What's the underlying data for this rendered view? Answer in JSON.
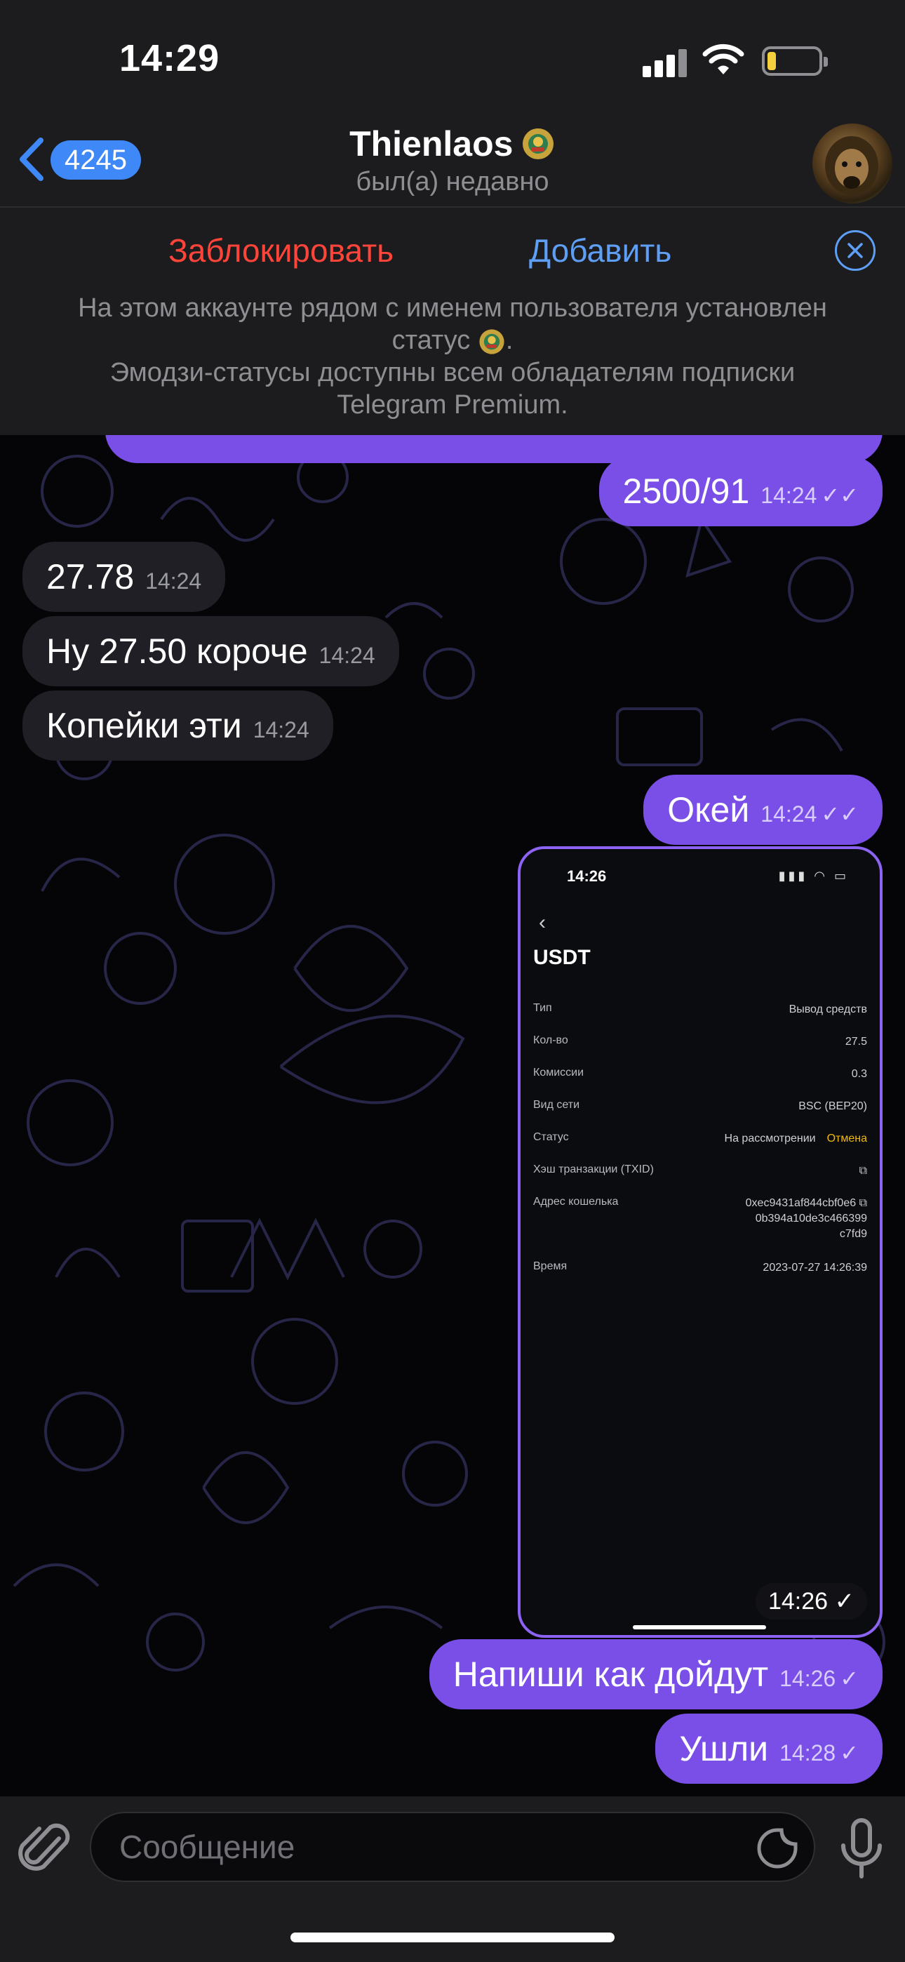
{
  "status_bar": {
    "time": "14:29"
  },
  "header": {
    "back_count": "4245",
    "title": "Thienlaos",
    "subtitle": "был(а) недавно"
  },
  "banner": {
    "block_label": "Заблокировать",
    "add_label": "Добавить",
    "line1": "На этом аккаунте рядом с именем пользователя установлен",
    "line2": "статус",
    "line3": "Эмодзи-статусы доступны всем обладателям подписки",
    "line4": "Telegram Premium."
  },
  "messages": [
    {
      "text": "2500/91",
      "time": "14:24",
      "direction": "out",
      "status": "read"
    },
    {
      "text": "27.78",
      "time": "14:24",
      "direction": "in"
    },
    {
      "text": "Ну 27.50 короче",
      "time": "14:24",
      "direction": "in"
    },
    {
      "text": "Копейки эти",
      "time": "14:24",
      "direction": "in"
    },
    {
      "text": "Окей",
      "time": "14:24",
      "direction": "out",
      "status": "read"
    },
    {
      "text": "Напиши как дойдут",
      "time": "14:26",
      "direction": "out",
      "status": "sent"
    },
    {
      "text": "Ушли",
      "time": "14:28",
      "direction": "out",
      "status": "sent"
    }
  ],
  "photo_message": {
    "time": "14:26",
    "status": "sent",
    "screenshot": {
      "time": "14:26",
      "title": "USDT",
      "rows": [
        {
          "label": "Тип",
          "value": "Вывод средств"
        },
        {
          "label": "Кол-во",
          "value": "27.5"
        },
        {
          "label": "Комиссии",
          "value": "0.3"
        },
        {
          "label": "Вид сети",
          "value": "BSC (BEP20)"
        },
        {
          "label": "Статус",
          "value": "На рассмотрении",
          "action": "Отмена"
        },
        {
          "label": "Хэш транзакции (TXID)",
          "value": "⧉"
        },
        {
          "label": "Адрес кошелька",
          "value_lines": [
            "0xec9431af844cbf0e6 ⧉",
            "0b394a10de3c466399",
            "c7fd9"
          ]
        },
        {
          "label": "Время",
          "value": "2023-07-27 14:26:39"
        }
      ]
    }
  },
  "input": {
    "placeholder": "Сообщение"
  },
  "icons": {
    "back": "chevron-left-icon",
    "emoji_status": "emoji-status-icon",
    "close": "close-circle-icon",
    "attach": "paperclip-icon",
    "sticker": "sticker-icon",
    "mic": "microphone-icon",
    "read": "double-check-icon",
    "sent": "single-check-icon"
  },
  "colors": {
    "accent": "#3e88f7",
    "outgoing_bubble": "#7a4fe8",
    "incoming_bubble": "#1f1f25",
    "danger": "#ff453a"
  }
}
